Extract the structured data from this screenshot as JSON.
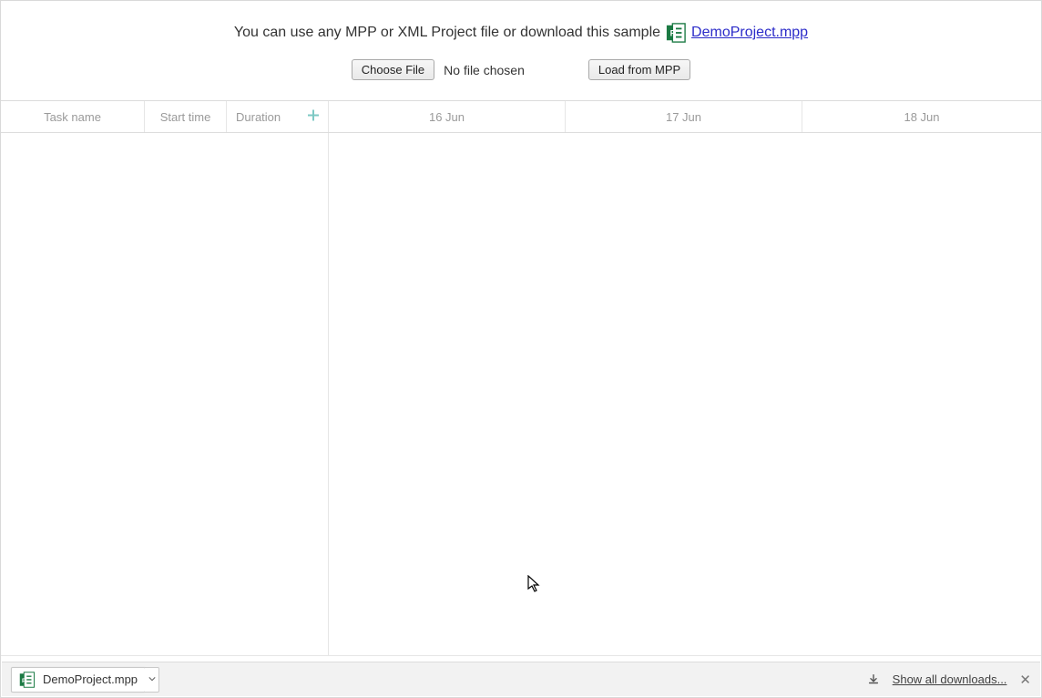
{
  "header": {
    "instruction_text": "You can use any MPP or XML Project file or download this sample",
    "sample_link_text": "DemoProject.mpp",
    "choose_file_label": "Choose File",
    "no_file_text": "No file chosen",
    "load_button_label": "Load from MPP"
  },
  "grid": {
    "columns": {
      "task_name": "Task name",
      "start_time": "Start time",
      "duration": "Duration"
    },
    "timeline_headers": [
      "16 Jun",
      "17 Jun",
      "18 Jun"
    ]
  },
  "download_bar": {
    "file_name": "DemoProject.mpp",
    "show_all_label": "Show all downloads..."
  },
  "icons": {
    "mpp": "mpp-file-icon",
    "plus": "add-column-icon",
    "download": "download-icon",
    "close": "close-icon",
    "caret": "chevron-down-icon",
    "cursor": "cursor-icon"
  }
}
